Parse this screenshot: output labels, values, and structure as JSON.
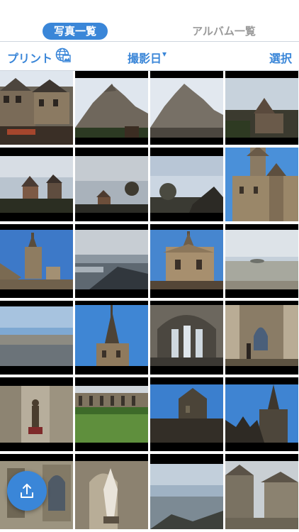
{
  "tabs": {
    "photos": "写真一覧",
    "albums": "アルバム一覧"
  },
  "toolbar": {
    "print_label": "プリント",
    "print_icon": "globe-photo-icon",
    "sort_label": "撮影日",
    "sort_caret": "▾",
    "select_label": "選択"
  },
  "upload_button": {
    "icon": "upload-icon"
  },
  "colors": {
    "accent": "#3a86d8",
    "inactive_tab": "#9a9a9a",
    "divider": "#cfd6de"
  },
  "photos": [
    {
      "subject": "half-timbered houses"
    },
    {
      "subject": "Mont Saint-Michel rock"
    },
    {
      "subject": "Mont Saint-Michel rock"
    },
    {
      "subject": "village rooftops"
    },
    {
      "subject": "sunset village"
    },
    {
      "subject": "cloudy sky fields"
    },
    {
      "subject": "evening sky"
    },
    {
      "subject": "abbey tower"
    },
    {
      "subject": "abbey spire"
    },
    {
      "subject": "tidal flats clouds"
    },
    {
      "subject": "abbey facade"
    },
    {
      "subject": "bay horizon"
    },
    {
      "subject": "bay sands"
    },
    {
      "subject": "gothic spire"
    },
    {
      "subject": "cathedral interior"
    },
    {
      "subject": "stone corridor"
    },
    {
      "subject": "statue hall"
    },
    {
      "subject": "cloister garden"
    },
    {
      "subject": "abbey silhouette"
    },
    {
      "subject": "spire silhouette"
    },
    {
      "subject": "cloister arches"
    },
    {
      "subject": "sculpture"
    },
    {
      "subject": "misty bay"
    },
    {
      "subject": "village street"
    }
  ]
}
